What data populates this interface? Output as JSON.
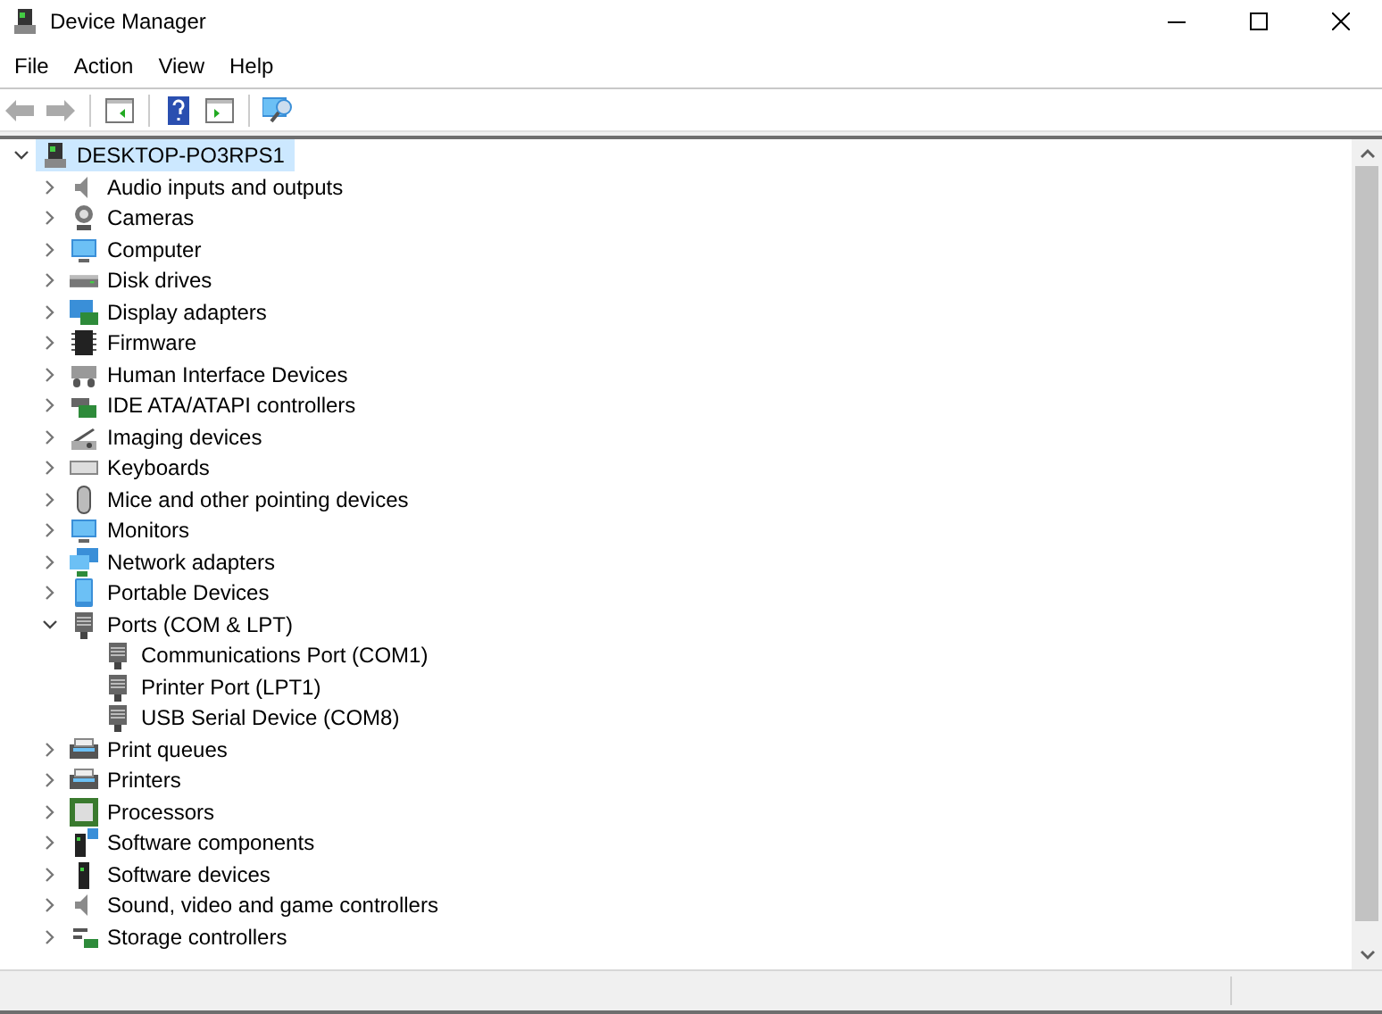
{
  "window": {
    "title": "Device Manager"
  },
  "menu": [
    "File",
    "Action",
    "View",
    "Help"
  ],
  "tree": {
    "label": "DESKTOP-PO3RPS1",
    "expanded": true,
    "selected": true,
    "children": [
      {
        "label": "Audio inputs and outputs",
        "expanded": false
      },
      {
        "label": "Cameras",
        "expanded": false
      },
      {
        "label": "Computer",
        "expanded": false
      },
      {
        "label": "Disk drives",
        "expanded": false
      },
      {
        "label": "Display adapters",
        "expanded": false
      },
      {
        "label": "Firmware",
        "expanded": false
      },
      {
        "label": "Human Interface Devices",
        "expanded": false
      },
      {
        "label": "IDE ATA/ATAPI controllers",
        "expanded": false
      },
      {
        "label": "Imaging devices",
        "expanded": false
      },
      {
        "label": "Keyboards",
        "expanded": false
      },
      {
        "label": "Mice and other pointing devices",
        "expanded": false
      },
      {
        "label": "Monitors",
        "expanded": false
      },
      {
        "label": "Network adapters",
        "expanded": false
      },
      {
        "label": "Portable Devices",
        "expanded": false
      },
      {
        "label": "Ports (COM & LPT)",
        "expanded": true,
        "children": [
          {
            "label": "Communications Port (COM1)"
          },
          {
            "label": "Printer Port (LPT1)"
          },
          {
            "label": "USB Serial Device (COM8)"
          }
        ]
      },
      {
        "label": "Print queues",
        "expanded": false
      },
      {
        "label": "Printers",
        "expanded": false
      },
      {
        "label": "Processors",
        "expanded": false
      },
      {
        "label": "Software components",
        "expanded": false
      },
      {
        "label": "Software devices",
        "expanded": false
      },
      {
        "label": "Sound, video and game controllers",
        "expanded": false
      },
      {
        "label": "Storage controllers",
        "expanded": false
      }
    ]
  }
}
